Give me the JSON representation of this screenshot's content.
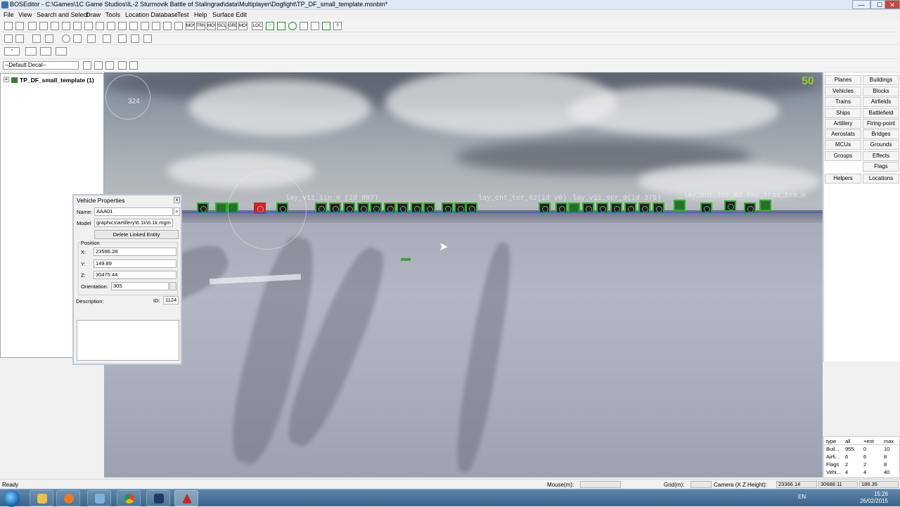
{
  "window": {
    "title": "BOSEditor - C:\\Games\\1C Game Studios\\IL-2 Sturmovik Battle of Stalingrad\\data\\Multiplayer\\Dogfight\\TP_DF_small_template.msnbin*",
    "min": "—",
    "max": "☐",
    "close": "✕"
  },
  "menu": [
    "File",
    "View",
    "Search and Select",
    "Draw",
    "Tools",
    "Location Database",
    "Test",
    "Help",
    "Surface Edit"
  ],
  "toolbar2": [
    "MOV",
    "TRN",
    "MOV",
    "SCL",
    "GRD",
    "MOV",
    "LOC"
  ],
  "decal": "--Default Decal--",
  "tree": {
    "root": "TP_DF_small_template (1)",
    "expander": "+"
  },
  "viewport": {
    "fps": "50",
    "compass": "324",
    "labels": [
      "lay_v11_11n_0 (id 807)",
      "lay_cnt_tcr_02(id v0)",
      "lay_v11_scr_0(id 375)",
      "lay_cnt_tcr_02 ray_tras_tra_0"
    ]
  },
  "vehicle_props": {
    "title": "Vehicle Properties",
    "name_label": "Name:",
    "name": "AAA01",
    "model_label": "Model",
    "model": "graphics\\artillery\\6.1k\\6.1k.mgm",
    "delete_btn": "Delete Linked Entity",
    "position_label": "Position",
    "x_label": "X:",
    "x": "23596.28",
    "y_label": "Y:",
    "y": "149.89",
    "z_label": "Z:",
    "z": "30475.44",
    "orient_label": "Orientation:",
    "orient": "305",
    "desc_label": "Description:",
    "id_label": "ID:",
    "id": "1124",
    "close": "x",
    "pick": ">"
  },
  "right_panel": {
    "left": [
      "Planes",
      "Vehicles",
      "Trains",
      "Ships",
      "Artillery",
      "Aerostats",
      "MCUs",
      "Groups"
    ],
    "right": [
      "Buildings",
      "Blocks",
      "Airfields",
      "Battlefield",
      "Firing-point",
      "Bridges",
      "Grounds",
      "Effects",
      "Flags"
    ],
    "helpers": "Helpers",
    "locations": "Locations"
  },
  "stats": {
    "headers": [
      "type",
      "all",
      "+ent",
      "max"
    ],
    "rows": [
      [
        "Buil...",
        "955",
        "0",
        "10"
      ],
      [
        "Airfi...",
        "6",
        "6",
        "8"
      ],
      [
        "Flags",
        "2",
        "2",
        "8"
      ],
      [
        "Vehi...",
        "4",
        "4",
        "40"
      ]
    ]
  },
  "status": {
    "ready": "Ready",
    "mouse": "Mouse(m):",
    "grid": "Grid(m):",
    "camera": "Camera (X Z Height):",
    "cam_x": "23366.14",
    "cam_z": "30688.11",
    "cam_h": "186.35"
  },
  "taskbar": {
    "lang": "EN",
    "time": "15:26",
    "date": "26/02/2015"
  },
  "colors": {
    "accent": "#2fae2f",
    "fps": "#9acd32"
  }
}
